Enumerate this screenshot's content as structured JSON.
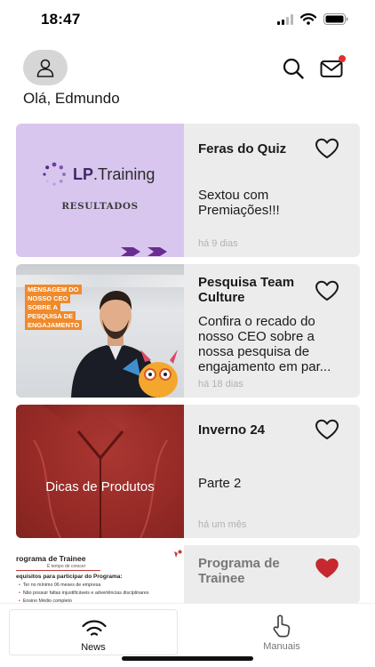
{
  "status_bar": {
    "time": "18:47",
    "icons": [
      "signal-icon",
      "wifi-icon",
      "battery-icon"
    ]
  },
  "header": {
    "greeting": "Olá, Edmundo",
    "icons": [
      "avatar-person-icon",
      "search-icon",
      "mail-icon"
    ],
    "mail_has_notification": true
  },
  "colors": {
    "accent": "#c5282f",
    "notification": "#e0302f",
    "card_background": "#ececec",
    "date_text": "#b2b2b2"
  },
  "feed": [
    {
      "title": "Feras do Quiz",
      "description": "Sextou com Premiações!!!",
      "date": "há 9 dias",
      "liked": false,
      "thumbnail": {
        "brand_prefix": "LP",
        "brand_suffix": ".Training",
        "caption": "RESULTADOS"
      }
    },
    {
      "title": "Pesquisa Team Culture",
      "description": "Confira o recado do nosso CEO sobre a nossa pesquisa de engajamento em par...",
      "date": "há 18 dias",
      "liked": false,
      "thumbnail": {
        "tags": [
          "MENSAGEM DO",
          "NOSSO CEO",
          "SOBRE A",
          "PESQUISA DE",
          "ENGAJAMENTO"
        ]
      }
    },
    {
      "title": "Inverno 24",
      "description": "Parte 2",
      "date": "há um mês",
      "liked": false,
      "thumbnail": {
        "caption": "Dicas de Produtos"
      }
    },
    {
      "title": "Programa de Trainee",
      "description": "",
      "date": "",
      "liked": true,
      "thumbnail": {
        "doc_title": "rograma de Trainee",
        "doc_subtitle": "É tempo de crescer",
        "doc_requirements": "equisitos para participar do Programa:",
        "doc_items": [
          "Ter no mínimo 06 meses de empresa",
          "Não possuir faltas injustificáveis e advertências disciplinares",
          "Ensino Médio completo"
        ]
      }
    }
  ],
  "tabbar": {
    "tabs": [
      {
        "label": "News",
        "icon": "wifi-signal-icon",
        "active": true
      },
      {
        "label": "Manuais",
        "icon": "hand-pointer-icon",
        "active": false
      }
    ]
  }
}
